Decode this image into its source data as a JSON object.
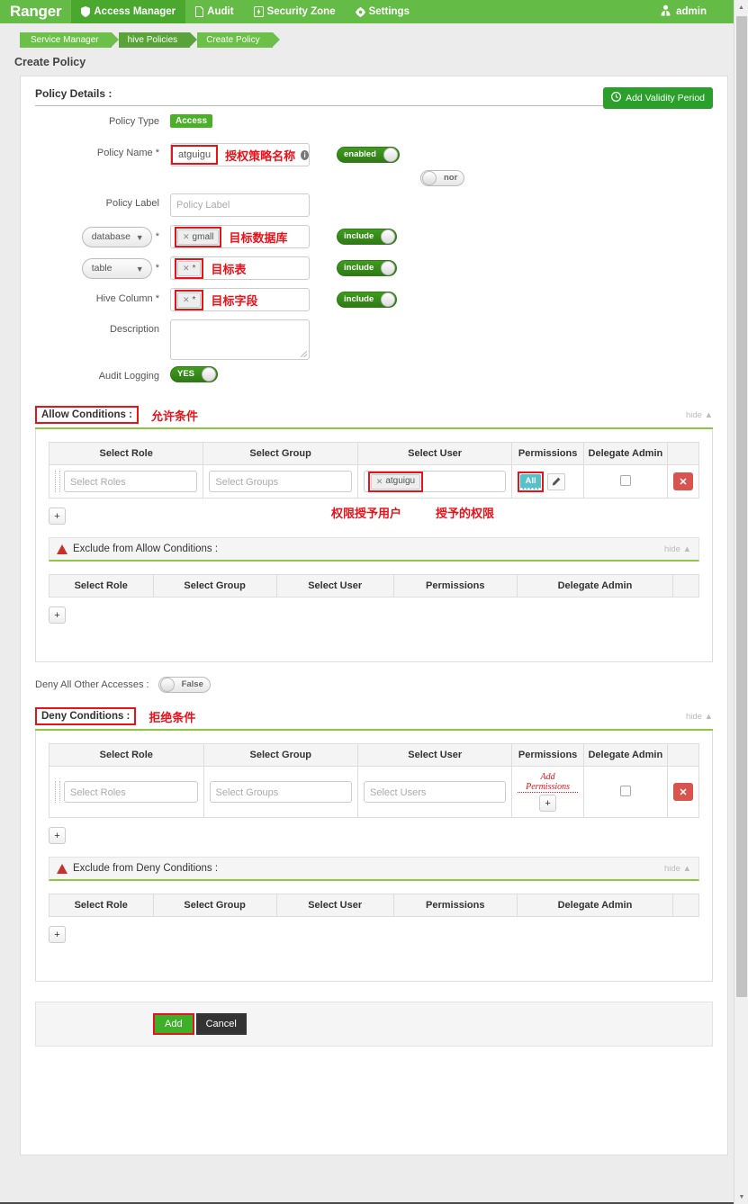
{
  "topnav": {
    "brand": "Ranger",
    "items": [
      {
        "label": "Access Manager",
        "icon": "shield-icon",
        "active": true
      },
      {
        "label": "Audit",
        "icon": "file-icon",
        "active": false
      },
      {
        "label": "Security Zone",
        "icon": "bolt-icon",
        "active": false
      },
      {
        "label": "Settings",
        "icon": "gear-icon",
        "active": false
      }
    ],
    "user": "admin"
  },
  "breadcrumb": [
    "Service Manager",
    "hive Policies",
    "Create Policy"
  ],
  "page_title": "Create Policy",
  "policy_details": {
    "section_title": "Policy Details :",
    "add_validity_label": "Add Validity Period",
    "policy_type_label": "Policy Type",
    "policy_type_value": "Access",
    "policy_name_label": "Policy Name *",
    "policy_name_value": "atguigu",
    "policy_name_annotation": "授权策略名称",
    "enabled_toggle": "enabled",
    "normal_toggle": "nor",
    "policy_label_label": "Policy Label",
    "policy_label_placeholder": "Policy Label",
    "resource_rows": [
      {
        "selector": "database",
        "selector_options": [
          "database"
        ],
        "required": "*",
        "token": "gmall",
        "annotation": "目标数据库",
        "toggle": "include",
        "is_select": true
      },
      {
        "selector": "table",
        "selector_options": [
          "table"
        ],
        "required": "*",
        "token": "*",
        "annotation": "目标表",
        "toggle": "include",
        "is_select": true
      },
      {
        "selector": "Hive Column *",
        "selector_options": [],
        "required": "",
        "token": "*",
        "annotation": "目标字段",
        "toggle": "include",
        "is_select": false
      }
    ],
    "description_label": "Description",
    "description_value": "",
    "audit_logging_label": "Audit Logging",
    "audit_logging_value": "YES"
  },
  "allow_conditions": {
    "title": "Allow Conditions :",
    "annotation": "允许条件",
    "hide_label": "hide",
    "columns": [
      "Select Role",
      "Select Group",
      "Select User",
      "Permissions",
      "Delegate Admin"
    ],
    "row": {
      "role_placeholder": "Select Roles",
      "group_placeholder": "Select Groups",
      "user_token": "atguigu",
      "permission_badge": "All",
      "user_annotation": "权限授予用户",
      "permission_annotation": "授予的权限"
    },
    "add_label": "+",
    "exclude": {
      "title": "Exclude from Allow Conditions :",
      "hide_label": "hide",
      "columns": [
        "Select Role",
        "Select Group",
        "Select User",
        "Permissions",
        "Delegate Admin"
      ],
      "add_label": "+"
    }
  },
  "deny_all_other": {
    "label": "Deny All Other Accesses :",
    "value": "False"
  },
  "deny_conditions": {
    "title": "Deny Conditions :",
    "annotation": "拒绝条件",
    "hide_label": "hide",
    "columns": [
      "Select Role",
      "Select Group",
      "Select User",
      "Permissions",
      "Delegate Admin"
    ],
    "row": {
      "role_placeholder": "Select Roles",
      "group_placeholder": "Select Groups",
      "user_placeholder": "Select Users",
      "add_permissions_label": "Add Permissions"
    },
    "add_label": "+",
    "exclude": {
      "title": "Exclude from Deny Conditions :",
      "hide_label": "hide",
      "columns": [
        "Select Role",
        "Select Group",
        "Select User",
        "Permissions",
        "Delegate Admin"
      ],
      "add_label": "+"
    }
  },
  "footer": {
    "add_label": "Add",
    "cancel_label": "Cancel"
  },
  "colors": {
    "brand_green": "#64bb46",
    "accent_green": "#8dc63f",
    "annotation_red": "#e8131a",
    "permission_teal": "#58c0c8",
    "delete_red": "#d9534f"
  }
}
